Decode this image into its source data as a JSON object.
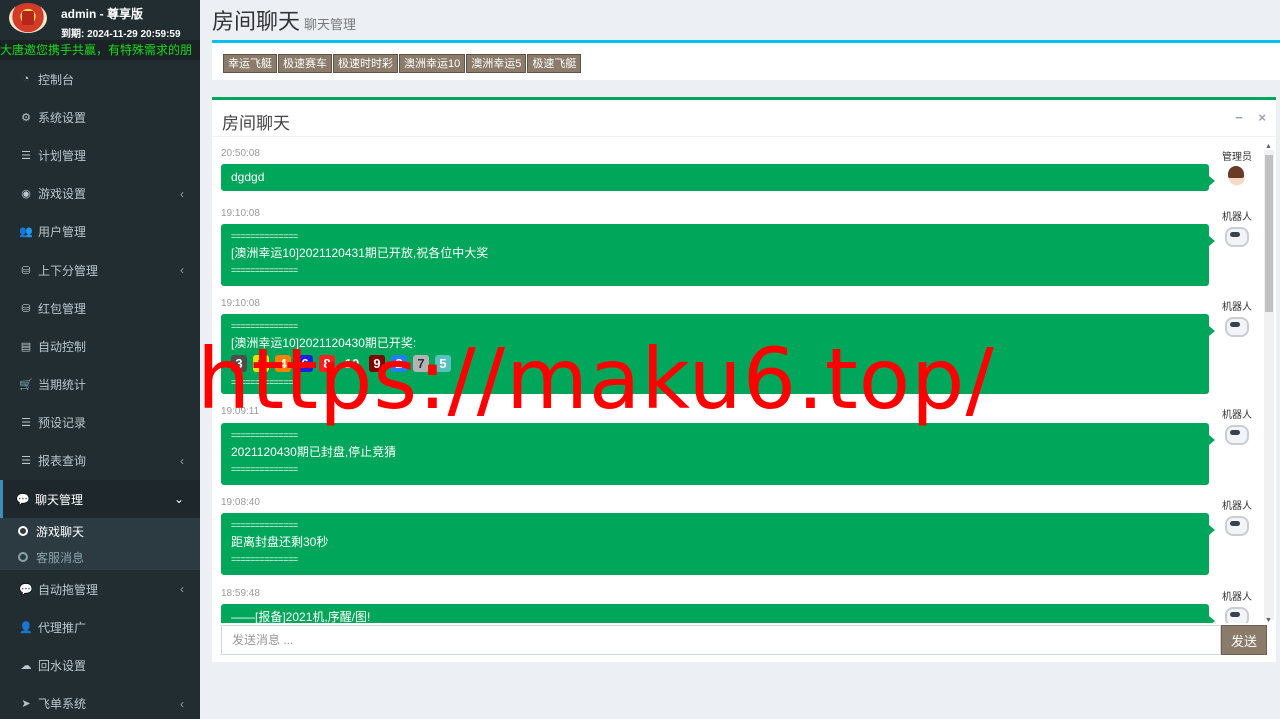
{
  "user": {
    "name": "admin - 尊享版",
    "expire": "到期: 2024-11-29 20:59:59"
  },
  "marquee": "大唐邀您携手共赢，有特殊需求的朋",
  "menu": [
    {
      "label": "控制台",
      "icon": "dashboard-icon",
      "glyph": "◔"
    },
    {
      "label": "系统设置",
      "icon": "cogs-icon",
      "glyph": "⚙"
    },
    {
      "label": "计划管理",
      "icon": "list-icon",
      "glyph": "☰"
    },
    {
      "label": "游戏设置",
      "icon": "gamepad-icon",
      "glyph": "◉"
    },
    {
      "label": "用户管理",
      "icon": "users-icon",
      "glyph": "👥"
    },
    {
      "label": "上下分管理",
      "icon": "database-icon",
      "glyph": "⛁"
    },
    {
      "label": "红包管理",
      "icon": "database-icon",
      "glyph": "⛁"
    },
    {
      "label": "自动控制",
      "icon": "list-alt-icon",
      "glyph": "▤"
    },
    {
      "label": "当期统计",
      "icon": "cart-icon",
      "glyph": "🛒"
    },
    {
      "label": "预设记录",
      "icon": "list-icon",
      "glyph": "☰"
    },
    {
      "label": "报表查询",
      "icon": "list-icon",
      "glyph": "☰"
    },
    {
      "label": "聊天管理",
      "icon": "comments-icon",
      "glyph": "💬"
    },
    {
      "label": "自动拖管理",
      "icon": "comment-icon",
      "glyph": "💬"
    },
    {
      "label": "代理推广",
      "icon": "user-plus-icon",
      "glyph": "👤"
    },
    {
      "label": "回水设置",
      "icon": "cloud-download-icon",
      "glyph": "☁"
    },
    {
      "label": "飞单系统",
      "icon": "paper-plane-icon",
      "glyph": "➤"
    }
  ],
  "submenu": [
    {
      "label": "游戏聊天"
    },
    {
      "label": "客服消息"
    }
  ],
  "header": {
    "title": "房间聊天",
    "subtitle": "聊天管理"
  },
  "tabs": [
    "幸运飞艇",
    "极速赛车",
    "极速时时彩",
    "澳洲幸运10",
    "澳洲幸运5",
    "极速飞艇"
  ],
  "chat": {
    "title": "房间聊天",
    "tools": {
      "minimize": "−",
      "close": "×"
    },
    "placeholder": "发送消息 ...",
    "send_label": "发送",
    "messages": [
      {
        "time": "20:50:08",
        "sender": "管理员",
        "lines": [
          "dgdgd"
        ]
      },
      {
        "time": "19:10:08",
        "sender": "机器人",
        "lines": [
          "==============",
          "[澳洲幸运10]2021120431期已开放,祝各位中大奖",
          "=============="
        ]
      },
      {
        "time": "19:10:08",
        "sender": "机器人",
        "lines": [
          "==============",
          "[澳洲幸运10]2021120430期已开奖:"
        ],
        "balls": [
          "3",
          "1",
          "4",
          "6",
          "8",
          "10",
          "9",
          "2",
          "7",
          "5"
        ],
        "after": "=============="
      },
      {
        "time": "19:09:11",
        "sender": "机器人",
        "lines": [
          "==============",
          "2021120430期已封盘,停止竞猜",
          "=============="
        ]
      },
      {
        "time": "19:08:40",
        "sender": "机器人",
        "lines": [
          "==============",
          "距离封盘还剩30秒",
          "=============="
        ]
      },
      {
        "time": "18:59:48",
        "sender": "机器人",
        "lines": [
          "——[报备]2021机,序醒/图!"
        ]
      }
    ],
    "ball_colors": {
      "1": "#e5e500",
      "2": "#1f7fff",
      "3": "#4d4d4d",
      "4": "#ff7f00",
      "5": "#55c1c1",
      "6": "#1f1fe0",
      "7": "#b3b3b3",
      "8": "#ff1f1f",
      "9": "#7f0000",
      "10": "#00a65a"
    }
  },
  "watermark": "https://maku6.top/",
  "colors": {
    "sidebar": "#222d32",
    "accent_green": "#00a65a",
    "accent_cyan": "#00c0ef",
    "tab_brown": "#8b7b6a",
    "watermark": "#ff0000"
  }
}
